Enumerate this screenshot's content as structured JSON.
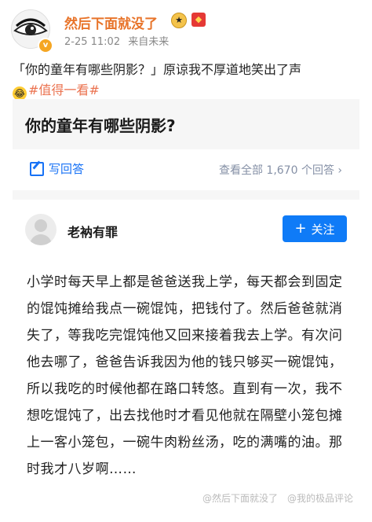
{
  "post": {
    "username": "然后下面就没了",
    "time": "2-25 11:02",
    "source": "来自未来",
    "text_main": "「你的童年有哪些阴影？」原谅我不厚道地笑出了声",
    "hashtag": "#值得一看#"
  },
  "question": {
    "title": "你的童年有哪些阴影?",
    "write_answer": "写回答",
    "view_all": "查看全部 1,670 个回答 ›"
  },
  "answer": {
    "author": "老衲有罪",
    "follow": "关注",
    "body": "小学时每天早上都是爸爸送我上学，每天都会到固定的馄饨摊给我点一碗馄饨，把钱付了。然后爸爸就消失了，等我吃完馄饨他又回来接着我去上学。有次问他去哪了，爸爸告诉我因为他的钱只够买一碗馄饨，所以我吃的时候他都在路口转悠。直到有一次，我不想吃馄饨了，出去找他时才看见他就在隔壁小笼包摊上一客小笼包，一碗牛肉粉丝汤，吃的满嘴的油。那时我才八岁啊……"
  },
  "watermark": {
    "left": "@然后下面就没了",
    "right": "@我的极品评论"
  },
  "colors": {
    "username": "#e8742a",
    "hashtag": "#eb7350",
    "accent": "#1772f6"
  }
}
